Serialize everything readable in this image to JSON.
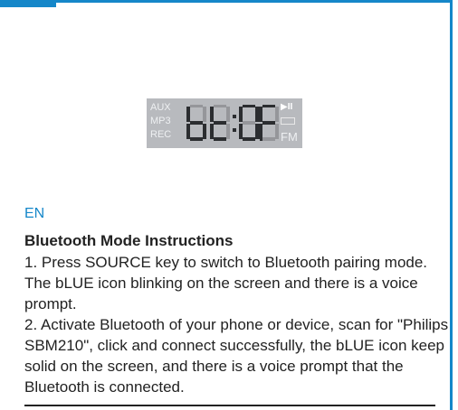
{
  "lcd": {
    "left_labels": [
      "AUX",
      "MP3",
      "REC"
    ],
    "display_text": "bt:0F",
    "play_pause_icon": "▶II",
    "battery_icon": "battery-icon",
    "right_label": "FM"
  },
  "section": {
    "language": "EN",
    "heading": "Bluetooth Mode Instructions",
    "instructions": [
      "1. Press SOURCE key to switch to Bluetooth pairing mode. The bLUE icon blinking on the screen and there is a voice prompt.",
      "2. Activate Bluetooth of your phone or device, scan for \"Philips SBM210\", click and connect successfully, the bLUE icon keep solid on the screen, and there is a voice prompt that the Bluetooth is connected."
    ]
  },
  "colors": {
    "accent": "#1587c9",
    "lcd_background": "#b8babe",
    "segment": "#2b2d30",
    "text": "#222222"
  }
}
